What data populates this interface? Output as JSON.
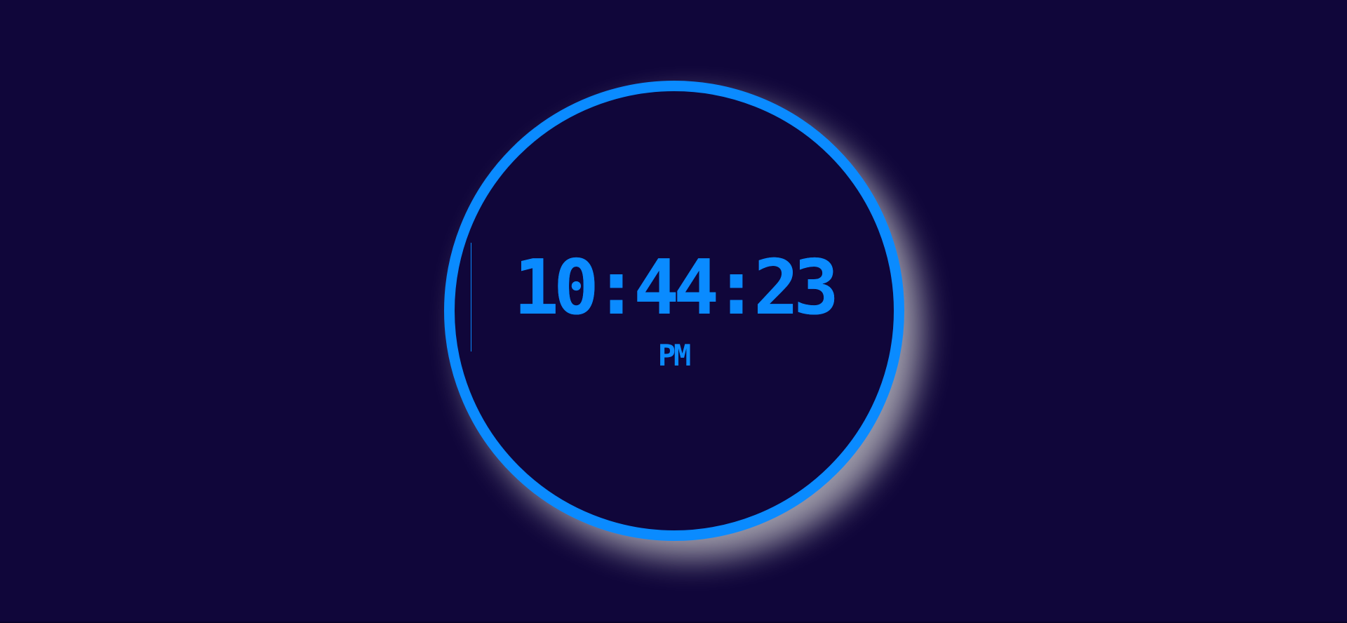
{
  "clock": {
    "hours": "10",
    "separator_1": ":",
    "minutes": "44",
    "separator_2": ":",
    "seconds": "23",
    "period": "PM"
  },
  "colors": {
    "background": "#10063a",
    "accent": "#0a8bff",
    "glow": "#d2d2d2"
  }
}
